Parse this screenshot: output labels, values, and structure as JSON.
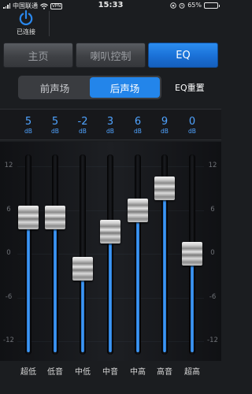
{
  "status_bar": {
    "carrier": "中国联通",
    "vpn": "VPN",
    "time": "15:33",
    "battery": "65%",
    "battery_level": 0.65
  },
  "header": {
    "connection_label": "已连接",
    "power_icon": "power-icon"
  },
  "nav": {
    "tabs": [
      {
        "label": "主页",
        "active": false
      },
      {
        "label": "喇叭控制",
        "active": false
      },
      {
        "label": "EQ",
        "active": true
      }
    ]
  },
  "sound_field": {
    "options": [
      {
        "label": "前声场",
        "active": false
      },
      {
        "label": "后声场",
        "active": true
      }
    ],
    "reset_label": "EQ重置"
  },
  "eq": {
    "unit": "dB",
    "db_scale": [
      "12",
      "6",
      "0",
      "-6",
      "-12"
    ],
    "range": [
      -12,
      12
    ],
    "bands": [
      {
        "name": "超低",
        "value": 5
      },
      {
        "name": "低音",
        "value": 5
      },
      {
        "name": "中低",
        "value": -2
      },
      {
        "name": "中音",
        "value": 3
      },
      {
        "name": "中高",
        "value": 6
      },
      {
        "name": "高音",
        "value": 9
      },
      {
        "name": "超高",
        "value": 0
      }
    ]
  },
  "colors": {
    "accent": "#2385ea",
    "value_text": "#4fa3ff",
    "background": "#1b1d20"
  }
}
